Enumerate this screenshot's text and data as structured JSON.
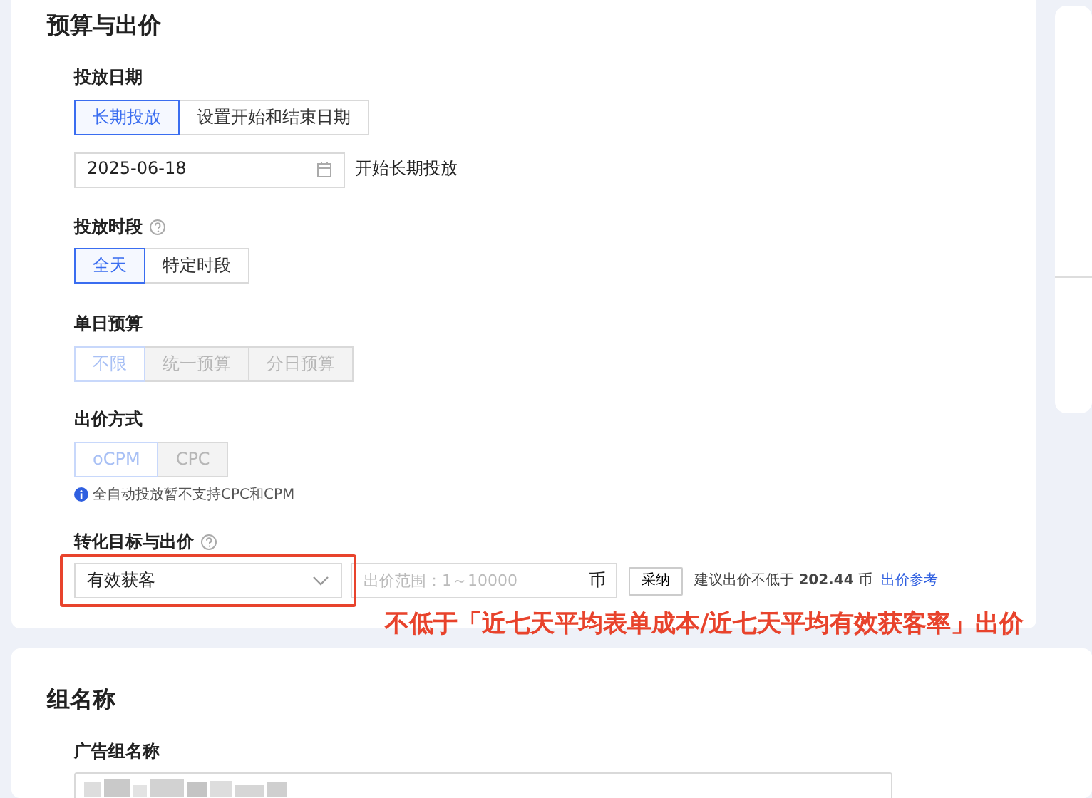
{
  "budget_section": {
    "title": "预算与出价",
    "fields": [
      {
        "kind": "segmented",
        "label": "投放日期",
        "help": false,
        "disabled": false,
        "options": [
          {
            "label": "长期投放",
            "selected": true
          },
          {
            "label": "设置开始和结束日期",
            "selected": false
          }
        ],
        "date": {
          "value": "2025-06-18",
          "note": "开始长期投放"
        }
      },
      {
        "kind": "segmented",
        "label": "投放时段",
        "help": true,
        "disabled": false,
        "options": [
          {
            "label": "全天",
            "selected": true
          },
          {
            "label": "特定时段",
            "selected": false
          }
        ]
      },
      {
        "kind": "segmented",
        "label": "单日预算",
        "help": false,
        "disabled": true,
        "options": [
          {
            "label": "不限",
            "selected": true
          },
          {
            "label": "统一预算",
            "selected": false
          },
          {
            "label": "分日预算",
            "selected": false
          }
        ]
      },
      {
        "kind": "segmented",
        "label": "出价方式",
        "help": false,
        "disabled": true,
        "options": [
          {
            "label": "oCPM",
            "selected": true
          },
          {
            "label": "CPC",
            "selected": false
          }
        ],
        "info": "全自动投放暂不支持CPC和CPM"
      },
      {
        "kind": "bid",
        "label": "转化目标与出价",
        "help": true,
        "goal": "有效获客",
        "bid_placeholder": "出价范围：1～10000",
        "unit": "币",
        "adopt": "采纳",
        "suggestion": "建议出价不低于 **202.44** 币",
        "link": "出价参考"
      }
    ]
  },
  "annotation": "不低于「近七天平均表单成本/近七天平均有效获客率」出价",
  "group_section": {
    "title": "组名称",
    "label": "广告组名称",
    "value_redacted": true
  }
}
